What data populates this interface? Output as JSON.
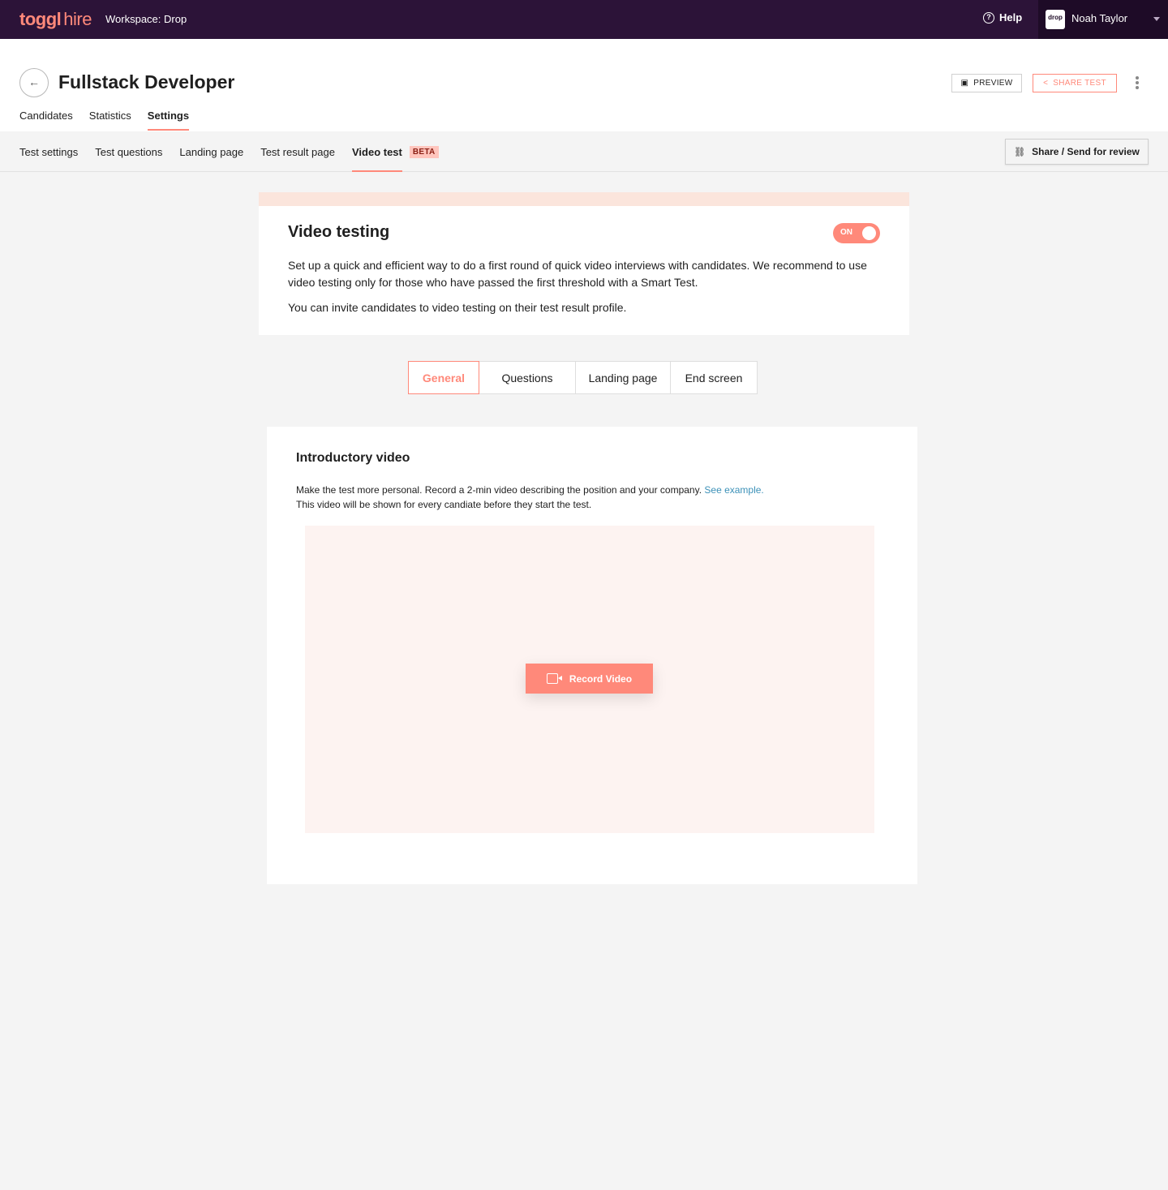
{
  "topbar": {
    "logo_bold": "toggl",
    "logo_light": "hire",
    "workspace": "Workspace: Drop",
    "help": "Help",
    "avatar_text": "drop",
    "user_name": "Noah Taylor"
  },
  "header": {
    "title": "Fullstack Developer",
    "preview": "PREVIEW",
    "share": "SHARE TEST",
    "tabs": [
      "Candidates",
      "Statistics",
      "Settings"
    ]
  },
  "subnav": {
    "tabs": [
      "Test settings",
      "Test questions",
      "Landing page",
      "Test result page",
      "Video test"
    ],
    "beta": "BETA",
    "review": "Share / Send for review"
  },
  "video_testing": {
    "title": "Video testing",
    "toggle": "ON",
    "p1": "Set up a quick and efficient way to do a first round of quick video interviews with candidates. We recommend to use video testing only for those who have passed the first threshold with a Smart Test.",
    "p2": "You can invite candidates to video testing on their test result profile."
  },
  "segments": [
    "General",
    "Questions",
    "Landing page",
    "End screen"
  ],
  "intro": {
    "title": "Introductory video",
    "line1": "Make the test more personal. Record a 2-min video describing the position and your company.",
    "link": "See example.",
    "line2": "This video will be shown for every candiate before they start the test.",
    "record": "Record Video"
  },
  "colors": {
    "accent": "#ff897a",
    "topbar": "#2c1338",
    "link": "#3c91b8"
  }
}
